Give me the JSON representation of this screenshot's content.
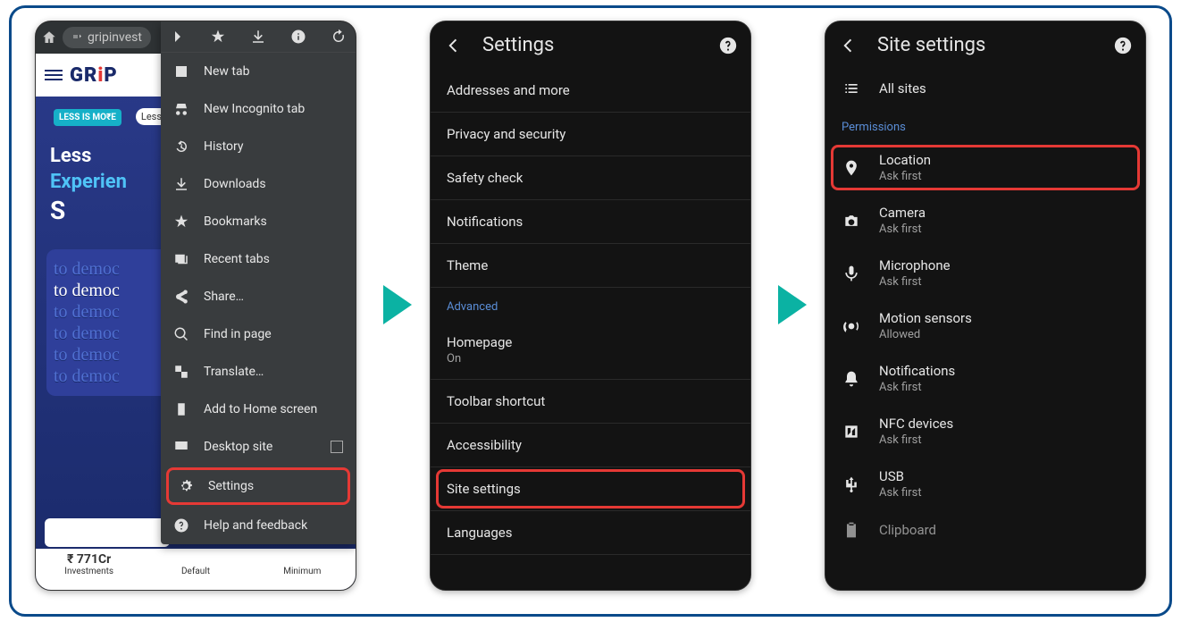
{
  "phone1": {
    "url": "gripinvest",
    "web": {
      "logo": "GRiP",
      "less_badge": "LESS IS MO₹E",
      "less_pill": "Less m",
      "hero_line1": "Less",
      "hero_line2": "Experien",
      "hero_line3": "S",
      "demo_text": "to democ",
      "stat_amount": "₹ 771Cr",
      "stat_label1": "Investments",
      "stat_label2": "Default",
      "stat_label3": "Minimum"
    },
    "menu_items": [
      "New tab",
      "New Incognito tab",
      "History",
      "Downloads",
      "Bookmarks",
      "Recent tabs",
      "Share…",
      "Find in page",
      "Translate…",
      "Add to Home screen",
      "Desktop site",
      "Settings",
      "Help and feedback"
    ]
  },
  "phone2": {
    "title": "Settings",
    "rows": [
      "Addresses and more",
      "Privacy and security",
      "Safety check",
      "Notifications",
      "Theme"
    ],
    "section": "Advanced",
    "rows2": [
      {
        "label": "Homepage",
        "sub": "On"
      },
      {
        "label": "Toolbar shortcut",
        "sub": ""
      },
      {
        "label": "Accessibility",
        "sub": ""
      },
      {
        "label": "Site settings",
        "sub": "",
        "highlight": true
      },
      {
        "label": "Languages",
        "sub": ""
      }
    ]
  },
  "phone3": {
    "title": "Site settings",
    "all_sites": "All sites",
    "section": "Permissions",
    "perms": [
      {
        "label": "Location",
        "sub": "Ask first",
        "highlight": true
      },
      {
        "label": "Camera",
        "sub": "Ask first"
      },
      {
        "label": "Microphone",
        "sub": "Ask first"
      },
      {
        "label": "Motion sensors",
        "sub": "Allowed"
      },
      {
        "label": "Notifications",
        "sub": "Ask first"
      },
      {
        "label": "NFC devices",
        "sub": "Ask first"
      },
      {
        "label": "USB",
        "sub": "Ask first"
      },
      {
        "label": "Clipboard",
        "sub": ""
      }
    ]
  }
}
